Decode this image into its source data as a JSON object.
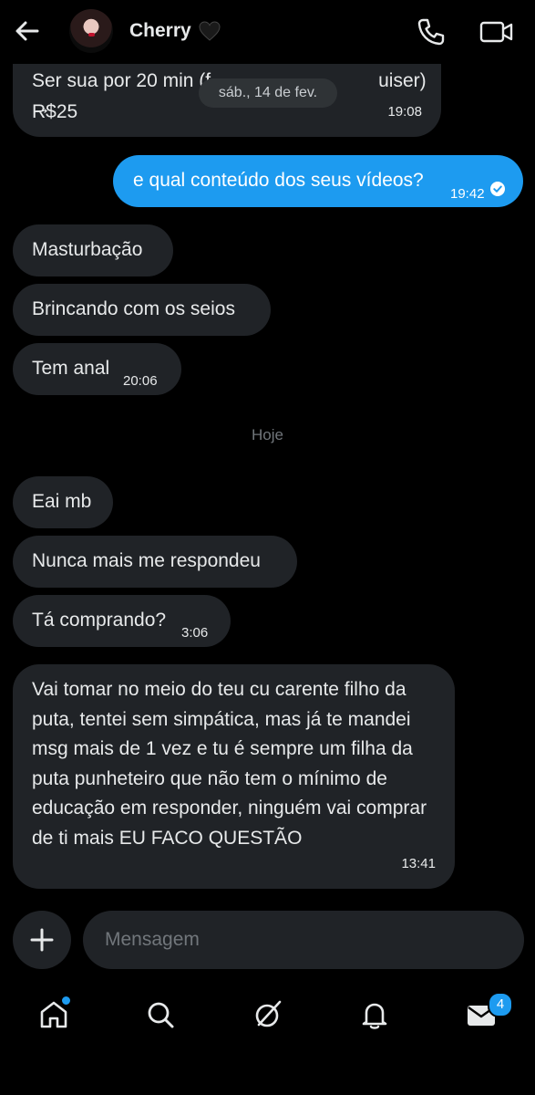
{
  "header": {
    "contact_name": "Cherry",
    "icons": {
      "back": "back-arrow-icon",
      "heart": "black-heart-emoji",
      "call": "phone-icon",
      "video": "video-camera-icon"
    }
  },
  "messages": [
    {
      "direction": "incoming",
      "lines": [
        "Ser sua por 20 min (f",
        "R$25"
      ],
      "time": "19:08",
      "partially_obscured": true
    },
    {
      "direction": "outgoing",
      "text": "e qual conteúdo dos seus vídeos?",
      "time": "19:42",
      "status": "read"
    },
    {
      "direction": "incoming",
      "text": "Masturbação"
    },
    {
      "direction": "incoming",
      "text": "Brincando com os seios"
    },
    {
      "direction": "incoming",
      "text": "Tem anal",
      "time": "20:06"
    },
    {
      "direction": "incoming",
      "text": "Eai mb"
    },
    {
      "direction": "incoming",
      "text": "Nunca mais me respondeu"
    },
    {
      "direction": "incoming",
      "text": "Tá comprando?",
      "time": "3:06"
    },
    {
      "direction": "incoming",
      "text": "Vai tomar no meio do teu cu carente filho da puta, tentei sem simpática, mas já te mandei msg mais de 1 vez e tu é sempre um filha da puta punheteiro que não tem o mínimo de educação em responder, ninguém vai comprar de ti mais EU FACO QUESTÃO",
      "time": "13:41"
    }
  ],
  "first_message_trailing_visible": "uiser) →",
  "date_separators": {
    "floating": "sáb., 14 de fev.",
    "today": "Hoje"
  },
  "composer": {
    "placeholder": "Mensagem",
    "add_icon": "plus-icon"
  },
  "bottom_nav": {
    "items": [
      "home-icon",
      "search-icon",
      "grok-icon",
      "notifications-bell-icon",
      "messages-envelope-icon"
    ],
    "messages_badge": "4"
  },
  "colors": {
    "background": "#000000",
    "incoming_bubble": "#202327",
    "outgoing_bubble": "#1d9bf0",
    "accent": "#1d9bf0",
    "muted_text": "#71767b"
  }
}
